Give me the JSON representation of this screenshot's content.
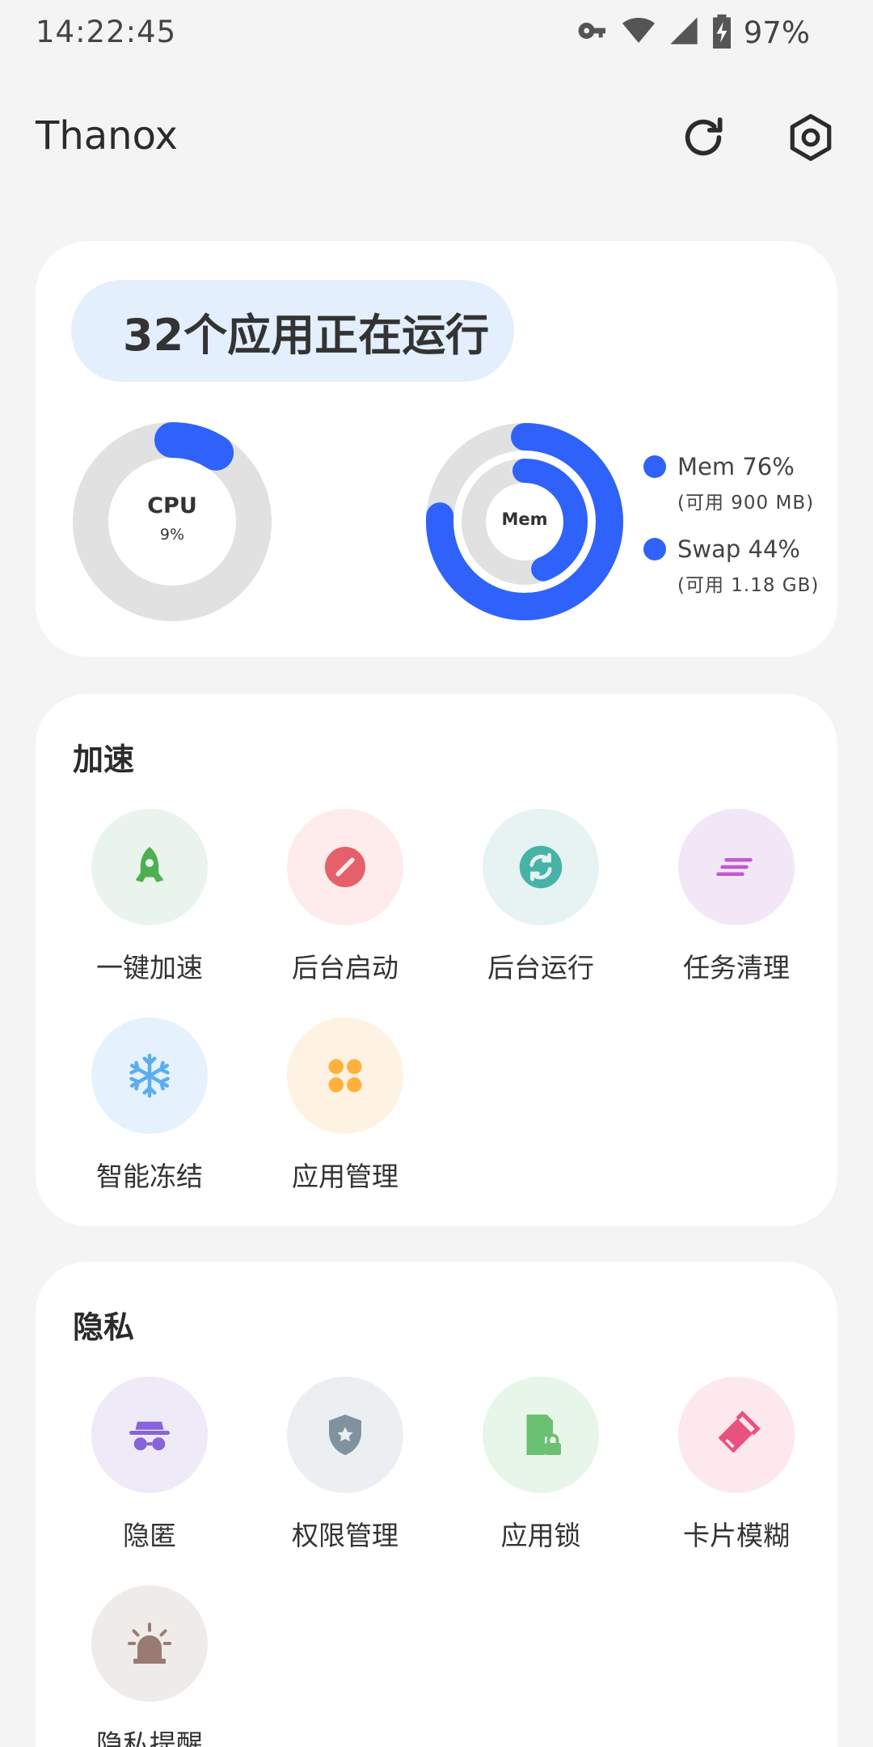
{
  "status_bar": {
    "time": "14:22:45",
    "battery_text": "97%",
    "icons": [
      "vpn-key-icon",
      "wifi-icon",
      "cell-signal-icon",
      "battery-charging-icon"
    ]
  },
  "app_bar": {
    "title": "Thanox",
    "actions": [
      "refresh-icon",
      "settings-gear-icon"
    ]
  },
  "status_card": {
    "running_text": "32个应用正在运行",
    "cpu": {
      "label": "CPU",
      "value_text": "9%",
      "percent": 9
    },
    "mem": {
      "label": "Mem",
      "percent": 76,
      "swap_percent": 44
    },
    "legend": [
      {
        "label": "Mem 76%",
        "sub": "(可用 900 MB)"
      },
      {
        "label": "Swap 44%",
        "sub": "(可用 1.18 GB)"
      }
    ],
    "colors": {
      "accent": "#2e62fb",
      "track": "#e1e1e1",
      "pill": "#e3effc"
    }
  },
  "boost": {
    "title": "加速",
    "items": [
      {
        "label": "一键加速",
        "icon": "rocket-icon",
        "bg": "#e9f5ec",
        "fg": "#4caf50"
      },
      {
        "label": "后台启动",
        "icon": "block-icon",
        "bg": "#fdeceb",
        "fg": "#e5606a"
      },
      {
        "label": "后台运行",
        "icon": "sync-icon",
        "bg": "#e6f3f2",
        "fg": "#46b3a6"
      },
      {
        "label": "任务清理",
        "icon": "clear-all-icon",
        "bg": "#f3e7f7",
        "fg": "#bf5bcc"
      },
      {
        "label": "智能冻结",
        "icon": "snowflake-icon",
        "bg": "#e5f2fd",
        "fg": "#5aaef0"
      },
      {
        "label": "应用管理",
        "icon": "apps-grid-icon",
        "bg": "#fef3e2",
        "fg": "#ffb13c"
      }
    ]
  },
  "privacy": {
    "title": "隐私",
    "items": [
      {
        "label": "隐匿",
        "icon": "incognito-icon",
        "bg": "#eeeaf8",
        "fg": "#8764d9"
      },
      {
        "label": "权限管理",
        "icon": "shield-star-icon",
        "bg": "#eceff1",
        "fg": "#7f939f"
      },
      {
        "label": "应用锁",
        "icon": "app-lock-icon",
        "bg": "#e8f5e9",
        "fg": "#6cc072"
      },
      {
        "label": "卡片模糊",
        "icon": "eraser-icon",
        "bg": "#fde8ee",
        "fg": "#e9527e"
      },
      {
        "label": "隐私提醒",
        "icon": "alarm-light-icon",
        "bg": "#efebe9",
        "fg": "#9a7b73"
      }
    ]
  }
}
